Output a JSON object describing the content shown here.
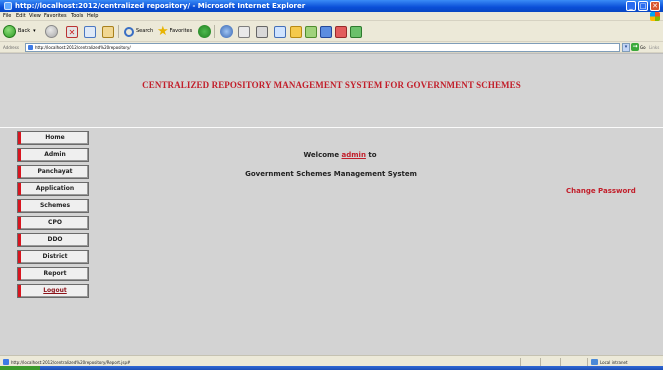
{
  "window": {
    "title": "http://localhost:2012/centralized repository/ - Microsoft Internet Explorer",
    "controls": {
      "minimize": "_",
      "maximize": "□",
      "close": "✕"
    }
  },
  "menu": [
    "File",
    "Edit",
    "View",
    "Favorites",
    "Tools",
    "Help"
  ],
  "toolbar": {
    "back_label": "Back",
    "search_label": "Search",
    "favorites_label": "Favorites"
  },
  "address": {
    "label": "Address",
    "url": "http://localhost:2012/centralized%20repository/",
    "go_label": "Go",
    "links_label": "Links"
  },
  "page": {
    "title": "CENTRALIZED REPOSITORY MANAGEMENT SYSTEM FOR GOVERNMENT SCHEMES",
    "nav": [
      "Home",
      "Admin",
      "Panchayat",
      "Application",
      "Schemes",
      "CPO",
      "DDO",
      "District",
      "Report"
    ],
    "logout_label": "Logout",
    "welcome_prefix": "Welcome",
    "username": "admin",
    "welcome_suffix": "to",
    "system_name": "Government Schemes Management System",
    "change_password": "Change Password"
  },
  "status": {
    "url": "http://localhost:2012/centralized%20repository/Report.jsp#",
    "zone": "Local intranet"
  },
  "colors": {
    "accent_red": "#c21e2a",
    "page_bg": "#d3d3d3",
    "titlebar_blue": "#0a4fd8"
  }
}
